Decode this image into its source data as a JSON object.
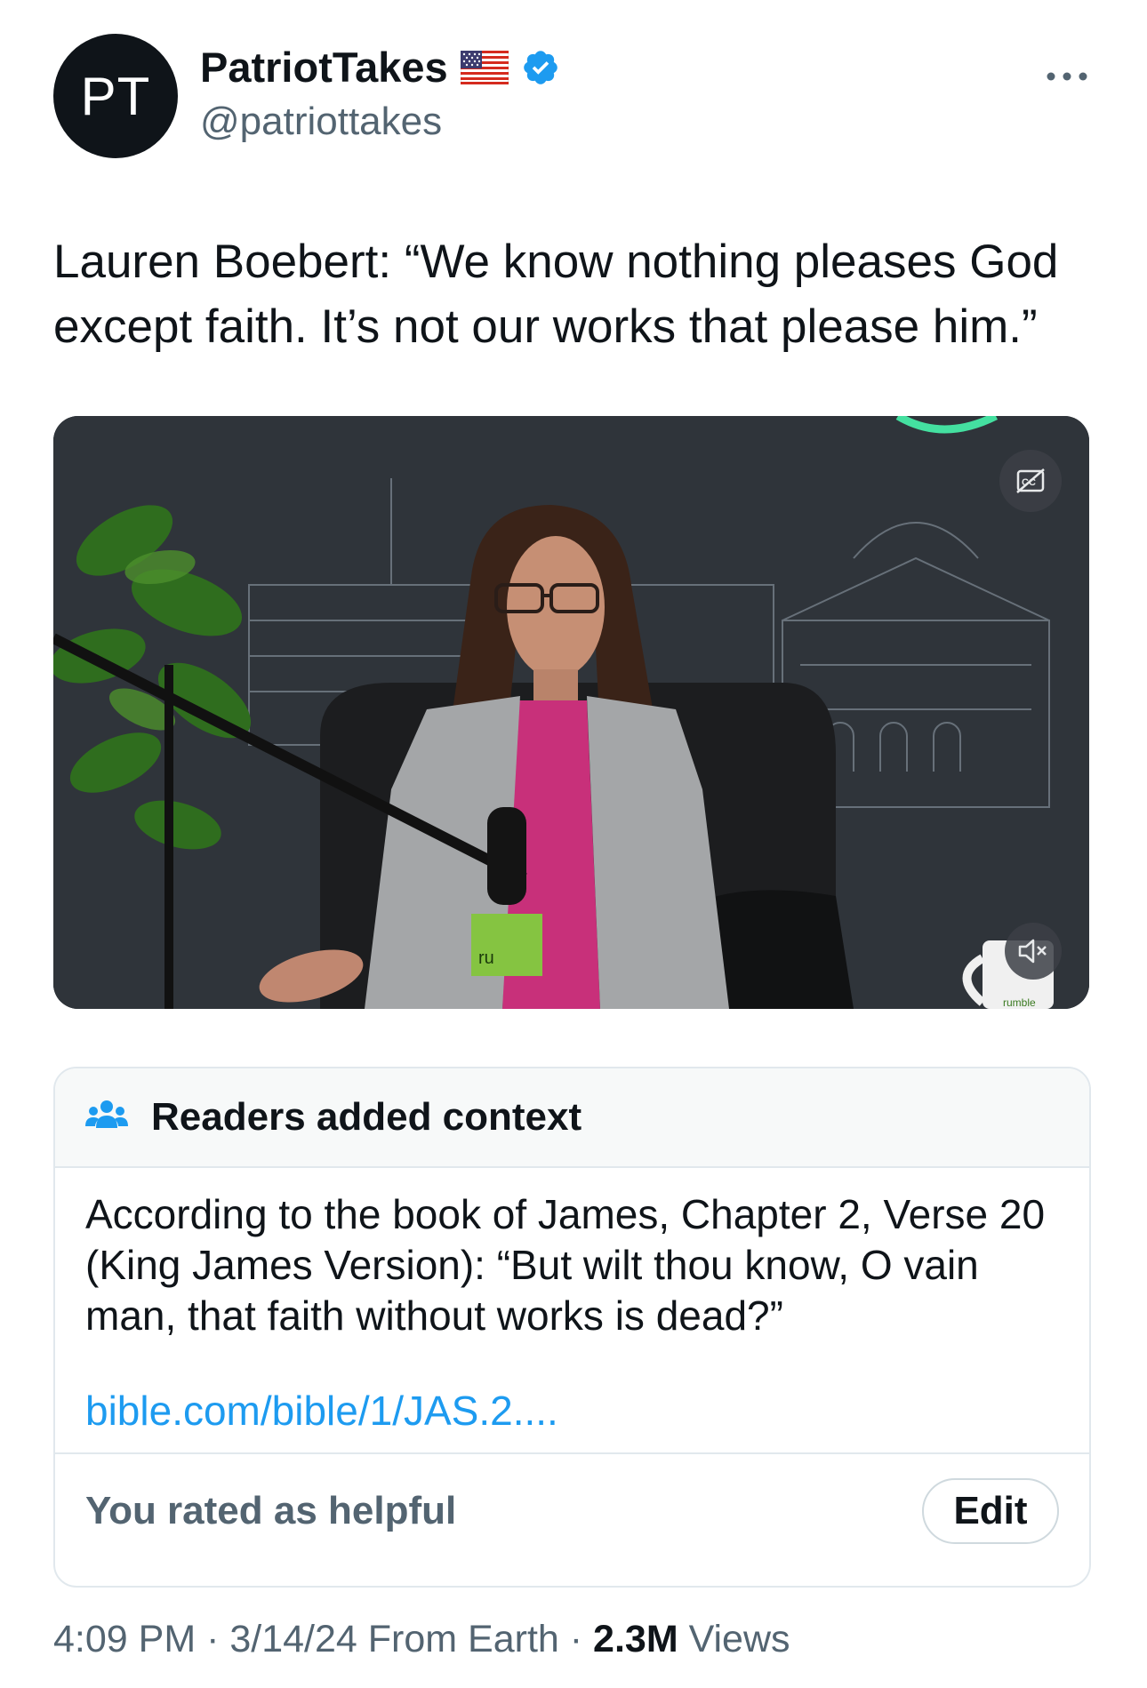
{
  "author": {
    "avatar_text": "PT",
    "display_name": "PatriotTakes",
    "handle": "@patriottakes"
  },
  "more_icon": "more-horizontal-icon",
  "tweet": {
    "text": "Lauren Boebert: “We know nothing pleases God except faith. It’s not our works that please him.”"
  },
  "media": {
    "type": "video",
    "watermark": "rumble",
    "mic_label": "ru",
    "captions_icon": "captions-off-icon",
    "mute_icon": "muted-speaker-icon"
  },
  "note": {
    "header_icon": "people-icon",
    "title": "Readers added context",
    "body": "According to the book of James, Chapter 2, Verse 20 (King James Version): “But wilt thou know, O vain man, that faith without works is dead?”",
    "link": "bible.com/bible/1/JAS.2....",
    "rated_text": "You rated as helpful",
    "edit_label": "Edit"
  },
  "meta": {
    "time": "4:09 PM",
    "sep1": " · ",
    "date": "3/14/24",
    "source": " From Earth",
    "sep2": " · ",
    "views_count": "2.3M",
    "views_label": " Views"
  },
  "colors": {
    "accent": "#1d9bf0",
    "text": "#0f1419",
    "secondary": "#536471",
    "border": "#e1e8ed"
  }
}
